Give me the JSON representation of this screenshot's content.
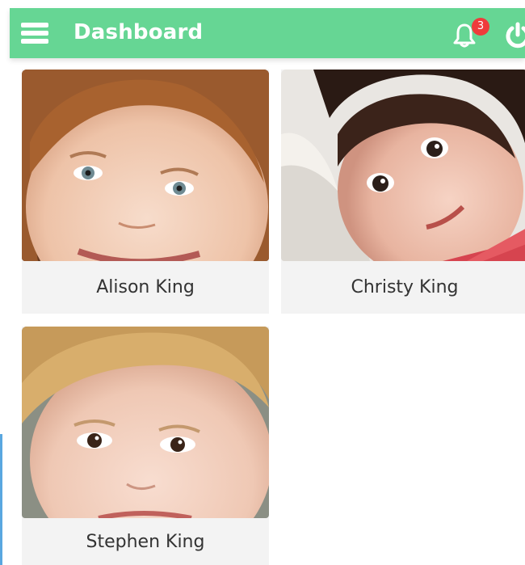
{
  "header": {
    "title": "Dashboard",
    "notification_count": "3",
    "menu_icon": "hamburger-menu-icon",
    "bell_icon": "bell-icon",
    "power_icon": "power-icon",
    "background_color": "#66d694",
    "badge_color": "#ef3b3b"
  },
  "children": [
    {
      "name": "Alison King"
    },
    {
      "name": "Christy King"
    },
    {
      "name": "Stephen King"
    }
  ]
}
